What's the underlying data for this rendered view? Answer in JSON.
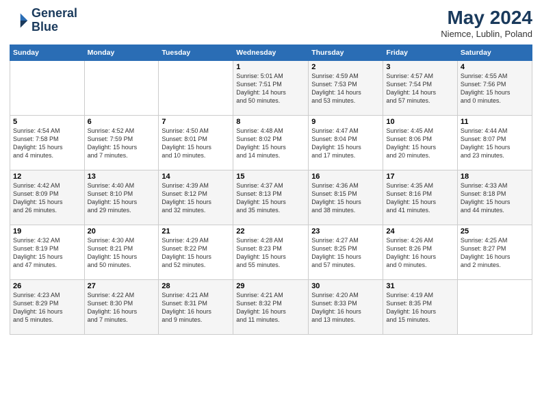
{
  "logo": {
    "text_line1": "General",
    "text_line2": "Blue"
  },
  "calendar": {
    "title": "May 2024",
    "subtitle": "Niemce, Lublin, Poland",
    "days_of_week": [
      "Sunday",
      "Monday",
      "Tuesday",
      "Wednesday",
      "Thursday",
      "Friday",
      "Saturday"
    ],
    "weeks": [
      [
        {
          "num": "",
          "info": ""
        },
        {
          "num": "",
          "info": ""
        },
        {
          "num": "",
          "info": ""
        },
        {
          "num": "1",
          "info": "Sunrise: 5:01 AM\nSunset: 7:51 PM\nDaylight: 14 hours\nand 50 minutes."
        },
        {
          "num": "2",
          "info": "Sunrise: 4:59 AM\nSunset: 7:53 PM\nDaylight: 14 hours\nand 53 minutes."
        },
        {
          "num": "3",
          "info": "Sunrise: 4:57 AM\nSunset: 7:54 PM\nDaylight: 14 hours\nand 57 minutes."
        },
        {
          "num": "4",
          "info": "Sunrise: 4:55 AM\nSunset: 7:56 PM\nDaylight: 15 hours\nand 0 minutes."
        }
      ],
      [
        {
          "num": "5",
          "info": "Sunrise: 4:54 AM\nSunset: 7:58 PM\nDaylight: 15 hours\nand 4 minutes."
        },
        {
          "num": "6",
          "info": "Sunrise: 4:52 AM\nSunset: 7:59 PM\nDaylight: 15 hours\nand 7 minutes."
        },
        {
          "num": "7",
          "info": "Sunrise: 4:50 AM\nSunset: 8:01 PM\nDaylight: 15 hours\nand 10 minutes."
        },
        {
          "num": "8",
          "info": "Sunrise: 4:48 AM\nSunset: 8:02 PM\nDaylight: 15 hours\nand 14 minutes."
        },
        {
          "num": "9",
          "info": "Sunrise: 4:47 AM\nSunset: 8:04 PM\nDaylight: 15 hours\nand 17 minutes."
        },
        {
          "num": "10",
          "info": "Sunrise: 4:45 AM\nSunset: 8:06 PM\nDaylight: 15 hours\nand 20 minutes."
        },
        {
          "num": "11",
          "info": "Sunrise: 4:44 AM\nSunset: 8:07 PM\nDaylight: 15 hours\nand 23 minutes."
        }
      ],
      [
        {
          "num": "12",
          "info": "Sunrise: 4:42 AM\nSunset: 8:09 PM\nDaylight: 15 hours\nand 26 minutes."
        },
        {
          "num": "13",
          "info": "Sunrise: 4:40 AM\nSunset: 8:10 PM\nDaylight: 15 hours\nand 29 minutes."
        },
        {
          "num": "14",
          "info": "Sunrise: 4:39 AM\nSunset: 8:12 PM\nDaylight: 15 hours\nand 32 minutes."
        },
        {
          "num": "15",
          "info": "Sunrise: 4:37 AM\nSunset: 8:13 PM\nDaylight: 15 hours\nand 35 minutes."
        },
        {
          "num": "16",
          "info": "Sunrise: 4:36 AM\nSunset: 8:15 PM\nDaylight: 15 hours\nand 38 minutes."
        },
        {
          "num": "17",
          "info": "Sunrise: 4:35 AM\nSunset: 8:16 PM\nDaylight: 15 hours\nand 41 minutes."
        },
        {
          "num": "18",
          "info": "Sunrise: 4:33 AM\nSunset: 8:18 PM\nDaylight: 15 hours\nand 44 minutes."
        }
      ],
      [
        {
          "num": "19",
          "info": "Sunrise: 4:32 AM\nSunset: 8:19 PM\nDaylight: 15 hours\nand 47 minutes."
        },
        {
          "num": "20",
          "info": "Sunrise: 4:30 AM\nSunset: 8:21 PM\nDaylight: 15 hours\nand 50 minutes."
        },
        {
          "num": "21",
          "info": "Sunrise: 4:29 AM\nSunset: 8:22 PM\nDaylight: 15 hours\nand 52 minutes."
        },
        {
          "num": "22",
          "info": "Sunrise: 4:28 AM\nSunset: 8:23 PM\nDaylight: 15 hours\nand 55 minutes."
        },
        {
          "num": "23",
          "info": "Sunrise: 4:27 AM\nSunset: 8:25 PM\nDaylight: 15 hours\nand 57 minutes."
        },
        {
          "num": "24",
          "info": "Sunrise: 4:26 AM\nSunset: 8:26 PM\nDaylight: 16 hours\nand 0 minutes."
        },
        {
          "num": "25",
          "info": "Sunrise: 4:25 AM\nSunset: 8:27 PM\nDaylight: 16 hours\nand 2 minutes."
        }
      ],
      [
        {
          "num": "26",
          "info": "Sunrise: 4:23 AM\nSunset: 8:29 PM\nDaylight: 16 hours\nand 5 minutes."
        },
        {
          "num": "27",
          "info": "Sunrise: 4:22 AM\nSunset: 8:30 PM\nDaylight: 16 hours\nand 7 minutes."
        },
        {
          "num": "28",
          "info": "Sunrise: 4:21 AM\nSunset: 8:31 PM\nDaylight: 16 hours\nand 9 minutes."
        },
        {
          "num": "29",
          "info": "Sunrise: 4:21 AM\nSunset: 8:32 PM\nDaylight: 16 hours\nand 11 minutes."
        },
        {
          "num": "30",
          "info": "Sunrise: 4:20 AM\nSunset: 8:33 PM\nDaylight: 16 hours\nand 13 minutes."
        },
        {
          "num": "31",
          "info": "Sunrise: 4:19 AM\nSunset: 8:35 PM\nDaylight: 16 hours\nand 15 minutes."
        },
        {
          "num": "",
          "info": ""
        }
      ]
    ]
  }
}
